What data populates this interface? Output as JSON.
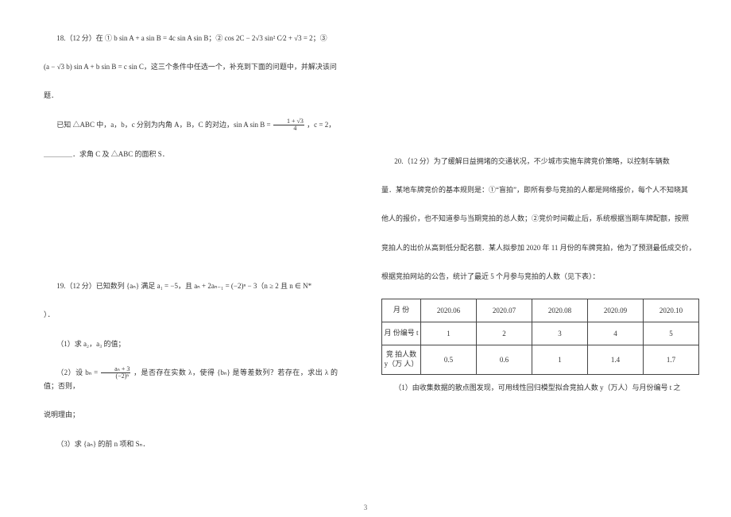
{
  "page_number": "3",
  "left": {
    "q18": {
      "head": "18.（12 分）在 ① b sin A + a sin B = 4c sin A sin B；② cos 2C − 2√3 sin² C⁄2 + √3 = 2；③",
      "line2": "(a − √3 b) sin A + b sin B = c sin C，这三个条件中任选一个，补充到下面的问题中，并解决该问",
      "line3": "题．",
      "line4_a": "已知 △ABC 中，a，b，c 分别为内角 A，B，C 的对边，sin A sin B = ",
      "line4_frac_num": "1 + √3",
      "line4_frac_den": "4",
      "line4_b": "，c = 2，",
      "line5": "＿＿＿＿．求角 C 及 △ABC 的面积 S．"
    },
    "q19": {
      "head": "19.（12 分）已知数列 {aₙ} 满足 a₁ = −5，且 aₙ + 2aₙ₋₁ = (−2)ⁿ − 3（n ≥ 2 且 n ∈ N*",
      "line2": "）．",
      "part1": "（1）求 a₂，a₃ 的值；",
      "part2_a": "（2）设 bₙ = ",
      "part2_frac_num": "aₙ + 3",
      "part2_frac_den": "(−2)ⁿ",
      "part2_b": "，是否存在实数 λ，使得 {bₙ} 是等差数列？若存在，求出 λ 的值；否则，",
      "part2_c": "说明理由；",
      "part3": "（3）求 {aₙ} 的前 n 项和 Sₙ．"
    }
  },
  "right": {
    "q20": {
      "head": "20.（12 分）为了缓解日益拥堵的交通状况，不少城市实施车牌竞价策略，以控制车辆数",
      "line2": "量．某地车牌竞价的基本规则是：①“盲拍”，即所有参与竞拍的人都是网络报价，每个人不知晓其",
      "line3": "他人的报价，也不知道参与当期竞拍的总人数；②竞价时间截止后，系统根据当期车牌配额，按照",
      "line4": "竞拍人的出价从高到低分配名额．某人拟参加 2020 年 11 月份的车牌竞拍，他为了预测最低成交价，",
      "line5": "根据竞拍网站的公告，统计了最近 5 个月参与竞拍的人数（见下表）：",
      "table": {
        "row1_label": "月\n份",
        "row1": [
          "2020.06",
          "2020.07",
          "2020.08",
          "2020.09",
          "2020.10"
        ],
        "row2_label": "月\n份编号 t",
        "row2": [
          "1",
          "2",
          "3",
          "4",
          "5"
        ],
        "row3_label": "竞\n拍人数\ny（万\n人）",
        "row3": [
          "0.5",
          "0.6",
          "1",
          "1.4",
          "1.7"
        ]
      },
      "after": "（1）由收集数据的散点图发现，可用线性回归模型拟合竞拍人数 y（万人）与月份编号 t 之"
    }
  }
}
